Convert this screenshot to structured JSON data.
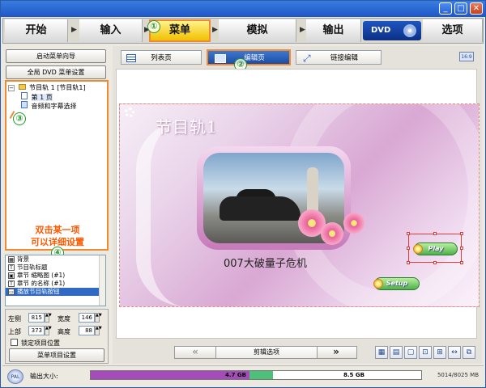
{
  "steps": {
    "start": "开始",
    "input": "输入",
    "menu": "菜单",
    "simulate": "模拟",
    "output": "输出",
    "dvd": "DVD",
    "options": "选项",
    "badge1": "①"
  },
  "left": {
    "wizard_btn": "启动菜单向导",
    "global_btn": "全局 DVD 菜单设置",
    "tree": {
      "root": "节目轨 1 [节目轨1]",
      "page": "第 1 页",
      "av": "音频和字幕选择"
    },
    "badge3": "③",
    "hint_line1": "双击某一项",
    "hint_line2": "可以详细设置",
    "badge4": "④",
    "props": [
      "背景",
      "节目轨标题",
      "章节 缩略图 (#1)",
      "章节 的名称 (#1)",
      "播放节目轨按钮"
    ],
    "geom": {
      "left_label": "左侧",
      "left_val": "815",
      "width_label": "宽度",
      "width_val": "146",
      "top_label": "上部",
      "top_val": "373",
      "height_label": "高度",
      "height_val": "88",
      "lock_label": "锁定项目位置",
      "settings_btn": "菜单项目设置"
    }
  },
  "main": {
    "tab_list": "列表页",
    "tab_edit": "编辑页",
    "tab_link": "链接编辑",
    "badge2": "②",
    "ratio": "16:9",
    "menu_title": "节目轨1",
    "movie_title": "007大破量子危机",
    "play_btn": "Play",
    "setup_btn": "Setup",
    "edit_options": "剪辑选项",
    "prev": "«",
    "next": "»"
  },
  "status": {
    "pal": "PAL",
    "size_label": "输出大小:",
    "mark1": "4.7 GB",
    "mark2": "8.5 GB",
    "used": "5014/8025 MB",
    "usage_percent": 48,
    "green_percent": 7
  }
}
